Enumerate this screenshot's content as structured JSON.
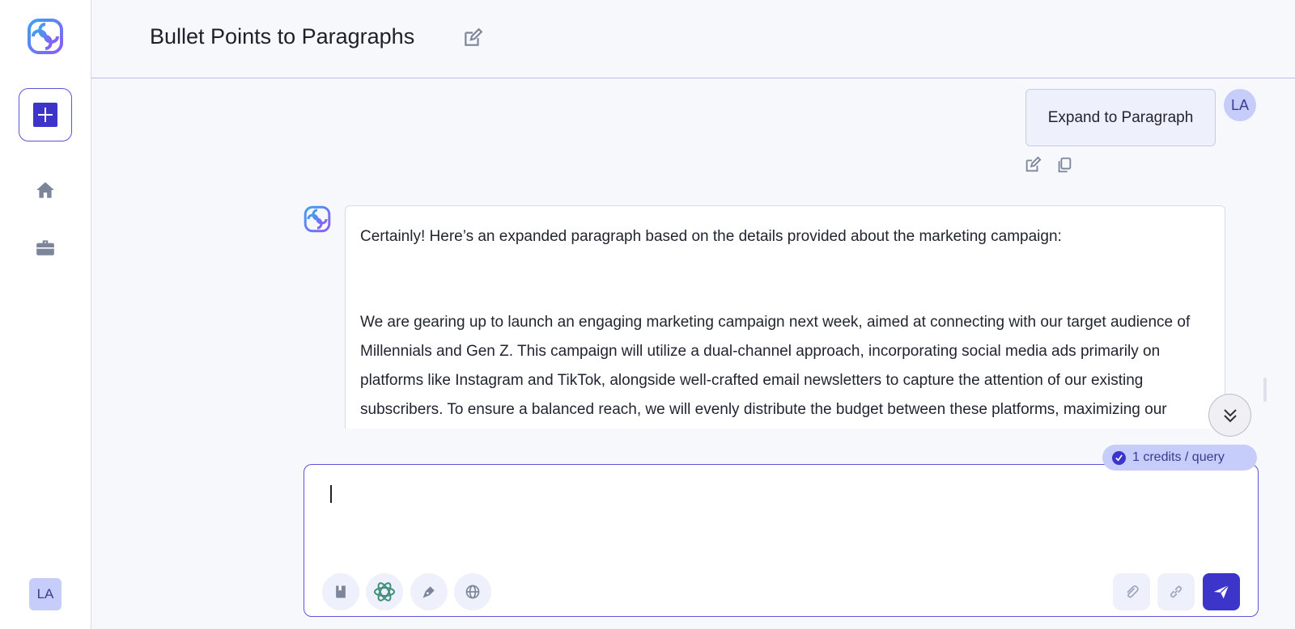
{
  "header": {
    "title": "Bullet Points to Paragraphs"
  },
  "sidebar": {
    "items": [
      {
        "icon": "home-icon"
      },
      {
        "icon": "briefcase-icon"
      }
    ],
    "user_initials": "LA"
  },
  "conversation": {
    "user_message": "Expand to Paragraph",
    "user_initials": "LA",
    "assistant_paragraphs": [
      "Certainly! Here’s an expanded paragraph based on the details provided about the marketing campaign:",
      "We are gearing up to launch an engaging marketing campaign next week, aimed at connecting with our target audience of Millennials and Gen Z. This campaign will utilize a dual-channel approach, incorporating social media ads primarily on platforms like Instagram and TikTok, alongside well-crafted email newsletters to capture the attention of our existing subscribers. To ensure a balanced reach, we will evenly distribute the budget between these platforms, maximizing our visibility across both. Performance will be tracked closely through key metrics."
    ]
  },
  "composer": {
    "credits_label": "1 credits / query",
    "value": "",
    "placeholder": ""
  },
  "colors": {
    "accent": "#3d35c9",
    "accent_light": "#c7cdfb",
    "border": "#5b55d8"
  }
}
